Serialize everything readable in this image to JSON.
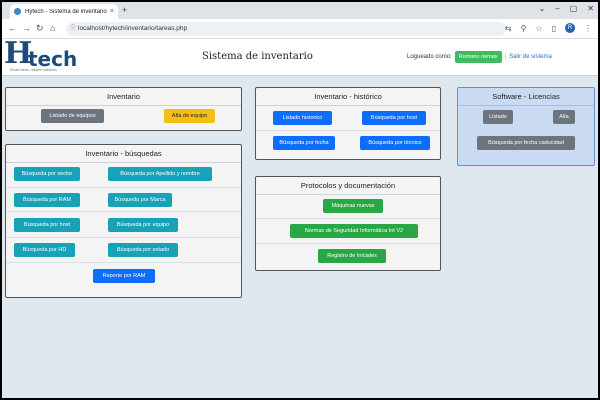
{
  "browser": {
    "tab_title": "Hytech - Sistema de inventario",
    "tab_close": "×",
    "new_tab": "+",
    "url": "localhost/hytech/inventario/tareas.php",
    "icons": [
      "back-icon",
      "forward-icon",
      "reload-icon",
      "home-icon",
      "lock-icon",
      "share-icon",
      "zoom-icon",
      "star-icon",
      "profile-icon"
    ],
    "profile_initial": "R"
  },
  "header": {
    "logo_text": "Hytech",
    "logo_tagline": "Smart ideas, reliable solutions",
    "title": "Sistema de inventario",
    "logged_label": "Logueado como:",
    "user": "Romano riemax",
    "separator": "|",
    "logout": "Salir de sistema"
  },
  "inventario": {
    "title": "Inventario",
    "buttons": [
      "Listado de equipos",
      "Alta de equipo"
    ]
  },
  "busquedas": {
    "title": "Inventario - búsquedas",
    "buttons": [
      "Búsqueda por sector",
      "Búsqueda por Apellido y nombre",
      "Búsqueda por RAM",
      "Búsqueda por Marca",
      "Búsqueda por host",
      "Búsqueda por equipo",
      "Búsqueda por HD",
      "Búsqueda por estado",
      "Reporte por RAM"
    ]
  },
  "historico": {
    "title": "Inventario - histórico",
    "buttons": [
      "Listado historico",
      "Búsqueda por host",
      "Búsqueda por fecha",
      "Búsqueda por técnico"
    ]
  },
  "protocolos": {
    "title": "Protocolos y documentación",
    "buttons": [
      "Máquinas nuevas",
      "Normas de Seguridad Informática Int V2",
      "Registro de Iniciales"
    ]
  },
  "software": {
    "title": "Software - Licencias",
    "buttons": [
      "Listado",
      "Alta",
      "Búsqueda por fecha caducidad"
    ]
  },
  "colors": {
    "gray": "#6c757d",
    "yellow": "#f5be17",
    "blue": "#0d6efd",
    "teal": "#17a2b8",
    "green": "#28a745",
    "licencias_bg": "#c9daf2"
  }
}
